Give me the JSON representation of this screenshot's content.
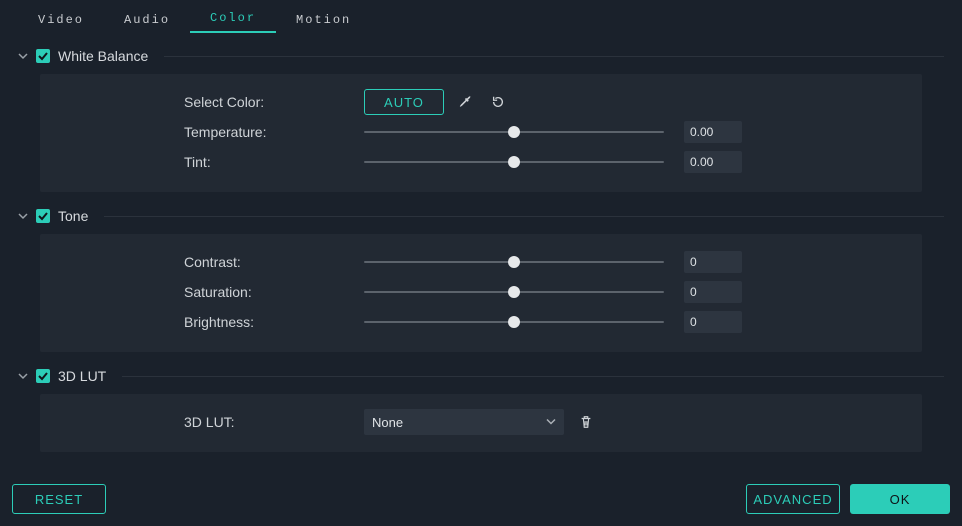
{
  "tabs": {
    "video": "Video",
    "audio": "Audio",
    "color": "Color",
    "motion": "Motion",
    "active": "color"
  },
  "sections": {
    "white_balance": {
      "title": "White Balance",
      "enabled": true,
      "select_color_label": "Select Color:",
      "auto_label": "AUTO",
      "temperature_label": "Temperature:",
      "temperature_value": "0.00",
      "temperature_pos_pct": 50,
      "tint_label": "Tint:",
      "tint_value": "0.00",
      "tint_pos_pct": 50
    },
    "tone": {
      "title": "Tone",
      "enabled": true,
      "contrast_label": "Contrast:",
      "contrast_value": "0",
      "contrast_pos_pct": 50,
      "saturation_label": "Saturation:",
      "saturation_value": "0",
      "saturation_pos_pct": 50,
      "brightness_label": "Brightness:",
      "brightness_value": "0",
      "brightness_pos_pct": 50
    },
    "lut": {
      "title": "3D LUT",
      "enabled": true,
      "lut_label": "3D LUT:",
      "lut_value": "None"
    }
  },
  "footer": {
    "reset": "RESET",
    "advanced": "ADVANCED",
    "ok": "OK"
  },
  "colors": {
    "accent": "#2ccdb8"
  }
}
